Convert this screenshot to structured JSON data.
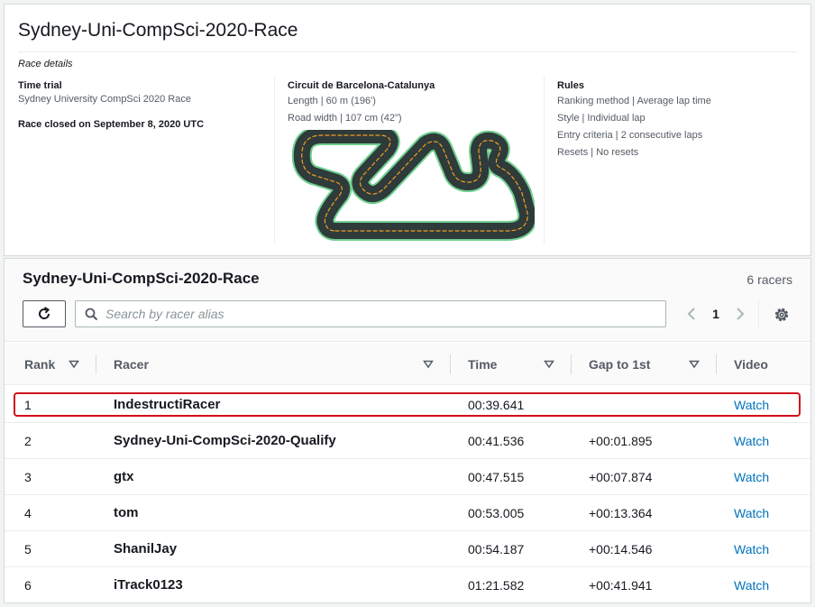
{
  "race": {
    "title": "Sydney-Uni-CompSci-2020-Race",
    "details_label": "Race details",
    "type_heading": "Time trial",
    "type_desc": "Sydney University CompSci 2020 Race",
    "closed_text": "Race closed on September 8, 2020 UTC"
  },
  "circuit": {
    "name": "Circuit de Barcelona-Catalunya",
    "length": "Length | 60 m (196')",
    "road_width": "Road width | 107 cm (42\")",
    "track_color": "#2f3a3b",
    "track_edge_color": "#6fcf8e",
    "lane_color": "#f0a020"
  },
  "rules": {
    "heading": "Rules",
    "items": [
      "Ranking method | Average lap time",
      "Style | Individual lap",
      "Entry criteria | 2 consecutive laps",
      "Resets | No resets"
    ]
  },
  "leaderboard": {
    "title": "Sydney-Uni-CompSci-2020-Race",
    "count": "6 racers",
    "search_placeholder": "Search by racer alias",
    "page": "1",
    "columns": [
      "Rank",
      "Racer",
      "Time",
      "Gap to 1st",
      "Video"
    ],
    "rows": [
      {
        "rank": "1",
        "racer": "IndestructiRacer",
        "time": "00:39.641",
        "gap": "",
        "video": "Watch"
      },
      {
        "rank": "2",
        "racer": "Sydney-Uni-CompSci-2020-Qualify",
        "time": "00:41.536",
        "gap": "+00:01.895",
        "video": "Watch"
      },
      {
        "rank": "3",
        "racer": "gtx",
        "time": "00:47.515",
        "gap": "+00:07.874",
        "video": "Watch"
      },
      {
        "rank": "4",
        "racer": "tom",
        "time": "00:53.005",
        "gap": "+00:13.364",
        "video": "Watch"
      },
      {
        "rank": "5",
        "racer": "ShanilJay",
        "time": "00:54.187",
        "gap": "+00:14.546",
        "video": "Watch"
      },
      {
        "rank": "6",
        "racer": "iTrack0123",
        "time": "01:21.582",
        "gap": "+00:41.941",
        "video": "Watch"
      }
    ],
    "highlight_color": "#d0101c",
    "link_color": "#0073bb"
  }
}
